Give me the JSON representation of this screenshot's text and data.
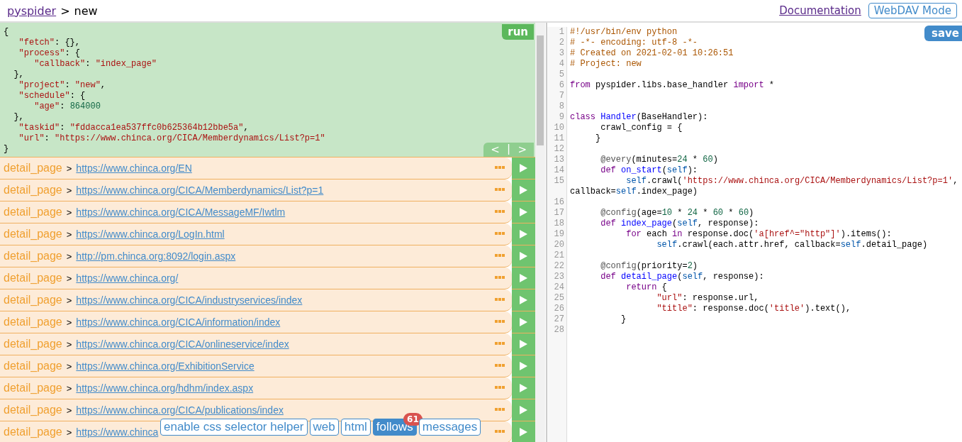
{
  "header": {
    "brand": "pyspider",
    "separator": ">",
    "project": "new",
    "links": [
      {
        "kind": "link",
        "label": "Documentation"
      },
      {
        "kind": "button",
        "label": "WebDAV Mode"
      }
    ]
  },
  "task": {
    "run_label": "run",
    "nav": {
      "prev": "<",
      "sep": "|",
      "next": ">"
    },
    "lines": [
      [
        {
          "kind": "plain",
          "t": "{"
        }
      ],
      [
        {
          "kind": "string",
          "t": "   \"fetch\""
        },
        {
          "kind": "plain",
          "t": ": {},"
        }
      ],
      [
        {
          "kind": "string",
          "t": "   \"process\""
        },
        {
          "kind": "plain",
          "t": ": {"
        }
      ],
      [
        {
          "kind": "string",
          "t": "      \"callback\""
        },
        {
          "kind": "plain",
          "t": ": "
        },
        {
          "kind": "string",
          "t": "\"index_page\""
        }
      ],
      [
        {
          "kind": "plain",
          "t": "  },"
        }
      ],
      [
        {
          "kind": "string",
          "t": "   \"project\""
        },
        {
          "kind": "plain",
          "t": ": "
        },
        {
          "kind": "string",
          "t": "\"new\""
        },
        {
          "kind": "plain",
          "t": ","
        }
      ],
      [
        {
          "kind": "string",
          "t": "   \"schedule\""
        },
        {
          "kind": "plain",
          "t": ": {"
        }
      ],
      [
        {
          "kind": "string",
          "t": "      \"age\""
        },
        {
          "kind": "plain",
          "t": ": "
        },
        {
          "kind": "number",
          "t": "864000"
        }
      ],
      [
        {
          "kind": "plain",
          "t": "  },"
        }
      ],
      [
        {
          "kind": "string",
          "t": "   \"taskid\""
        },
        {
          "kind": "plain",
          "t": ": "
        },
        {
          "kind": "string",
          "t": "\"fddacca1ea537ffc0b625364b12bbe5a\""
        },
        {
          "kind": "plain",
          "t": ","
        }
      ],
      [
        {
          "kind": "string",
          "t": "   \"url\""
        },
        {
          "kind": "plain",
          "t": ": "
        },
        {
          "kind": "string",
          "t": "\"https://www.chinca.org/CICA/Memberdynamics/List?p=1\""
        }
      ],
      [
        {
          "kind": "plain",
          "t": "}"
        }
      ]
    ]
  },
  "follows": [
    {
      "callback": "detail_page",
      "sep": ">",
      "url": "https://www.chinca.org/EN"
    },
    {
      "callback": "detail_page",
      "sep": ">",
      "url": "https://www.chinca.org/CICA/Memberdynamics/List?p=1"
    },
    {
      "callback": "detail_page",
      "sep": ">",
      "url": "https://www.chinca.org/CICA/MessageMF/Iwtlm"
    },
    {
      "callback": "detail_page",
      "sep": ">",
      "url": "https://www.chinca.org/LogIn.html"
    },
    {
      "callback": "detail_page",
      "sep": ">",
      "url": "http://pm.chinca.org:8092/login.aspx"
    },
    {
      "callback": "detail_page",
      "sep": ">",
      "url": "https://www.chinca.org/"
    },
    {
      "callback": "detail_page",
      "sep": ">",
      "url": "https://www.chinca.org/CICA/industryservices/index"
    },
    {
      "callback": "detail_page",
      "sep": ">",
      "url": "https://www.chinca.org/CICA/information/index"
    },
    {
      "callback": "detail_page",
      "sep": ">",
      "url": "https://www.chinca.org/CICA/onlineservice/index"
    },
    {
      "callback": "detail_page",
      "sep": ">",
      "url": "https://www.chinca.org/ExhibitionService"
    },
    {
      "callback": "detail_page",
      "sep": ">",
      "url": "https://www.chinca.org/hdhm/index.aspx"
    },
    {
      "callback": "detail_page",
      "sep": ">",
      "url": "https://www.chinca.org/CICA/publications/index"
    },
    {
      "callback": "detail_page",
      "sep": ">",
      "url": "https://www.chinca"
    }
  ],
  "toolbar": {
    "helper": "enable css selector helper",
    "tabs": [
      {
        "label": "web",
        "selected": false
      },
      {
        "label": "html",
        "selected": false
      },
      {
        "label": "follows",
        "selected": true,
        "badge": "61"
      },
      {
        "label": "messages",
        "selected": false
      }
    ]
  },
  "editor": {
    "save_label": "save",
    "lines": [
      {
        "n": "1",
        "segs": [
          {
            "kind": "comment",
            "t": "#!/usr/bin/env python"
          }
        ]
      },
      {
        "n": "2",
        "segs": [
          {
            "kind": "comment",
            "t": "# -*- encoding: utf-8 -*-"
          }
        ]
      },
      {
        "n": "3",
        "segs": [
          {
            "kind": "comment",
            "t": "# Created on 2021-02-01 10:26:51"
          }
        ]
      },
      {
        "n": "4",
        "segs": [
          {
            "kind": "comment",
            "t": "# Project: new"
          }
        ]
      },
      {
        "n": "5"
      },
      {
        "n": "6",
        "segs": [
          {
            "kind": "keyword",
            "t": "from"
          },
          {
            "kind": "plain",
            "t": " pyspider.libs.base_handler "
          },
          {
            "kind": "keyword",
            "t": "import"
          },
          {
            "kind": "plain",
            "t": " *"
          }
        ]
      },
      {
        "n": "7"
      },
      {
        "n": "8"
      },
      {
        "n": "9",
        "segs": [
          {
            "kind": "keyword",
            "t": "class"
          },
          {
            "kind": "def",
            "t": " Handler"
          },
          {
            "kind": "plain",
            "t": "(BaseHandler):"
          }
        ]
      },
      {
        "n": "10",
        "segs": [
          {
            "kind": "plain",
            "t": "      crawl_config = {"
          }
        ]
      },
      {
        "n": "11",
        "segs": [
          {
            "kind": "plain",
            "t": "     }"
          }
        ]
      },
      {
        "n": "12"
      },
      {
        "n": "13",
        "segs": [
          {
            "kind": "meta",
            "t": "      @every"
          },
          {
            "kind": "plain",
            "t": "(minutes="
          },
          {
            "kind": "number",
            "t": "24"
          },
          {
            "kind": "plain",
            "t": " * "
          },
          {
            "kind": "number",
            "t": "60"
          },
          {
            "kind": "plain",
            "t": ")"
          }
        ]
      },
      {
        "n": "14",
        "segs": [
          {
            "kind": "keyword",
            "t": "      def"
          },
          {
            "kind": "def",
            "t": " on_start"
          },
          {
            "kind": "plain",
            "t": "("
          },
          {
            "kind": "variable",
            "t": "self"
          },
          {
            "kind": "plain",
            "t": "):"
          }
        ]
      },
      {
        "n": "15",
        "segs": [
          {
            "kind": "variable",
            "t": "           self"
          },
          {
            "kind": "plain",
            "t": ".crawl("
          },
          {
            "kind": "string",
            "t": "'https://www.chinca.org/CICA/Memberdynamics/List?p=1'"
          },
          {
            "kind": "plain",
            "t": ","
          }
        ]
      },
      {
        "segs": [
          {
            "kind": "plain",
            "t": "callback="
          },
          {
            "kind": "variable",
            "t": "self"
          },
          {
            "kind": "plain",
            "t": ".index_page)"
          }
        ]
      },
      {
        "n": "16"
      },
      {
        "n": "17",
        "segs": [
          {
            "kind": "meta",
            "t": "      @config"
          },
          {
            "kind": "plain",
            "t": "(age="
          },
          {
            "kind": "number",
            "t": "10"
          },
          {
            "kind": "plain",
            "t": " * "
          },
          {
            "kind": "number",
            "t": "24"
          },
          {
            "kind": "plain",
            "t": " * "
          },
          {
            "kind": "number",
            "t": "60"
          },
          {
            "kind": "plain",
            "t": " * "
          },
          {
            "kind": "number",
            "t": "60"
          },
          {
            "kind": "plain",
            "t": ")"
          }
        ]
      },
      {
        "n": "18",
        "segs": [
          {
            "kind": "keyword",
            "t": "      def"
          },
          {
            "kind": "def",
            "t": " index_page"
          },
          {
            "kind": "plain",
            "t": "("
          },
          {
            "kind": "variable",
            "t": "self"
          },
          {
            "kind": "plain",
            "t": ", response):"
          }
        ]
      },
      {
        "n": "19",
        "segs": [
          {
            "kind": "keyword",
            "t": "           for"
          },
          {
            "kind": "plain",
            "t": " each "
          },
          {
            "kind": "keyword",
            "t": "in"
          },
          {
            "kind": "plain",
            "t": " response.doc("
          },
          {
            "kind": "string",
            "t": "'a[href^=\"http\"]'"
          },
          {
            "kind": "plain",
            "t": ").items():"
          }
        ]
      },
      {
        "n": "20",
        "segs": [
          {
            "kind": "variable",
            "t": "                 self"
          },
          {
            "kind": "plain",
            "t": ".crawl(each.attr.href, callback="
          },
          {
            "kind": "variable",
            "t": "self"
          },
          {
            "kind": "plain",
            "t": ".detail_page)"
          }
        ]
      },
      {
        "n": "21"
      },
      {
        "n": "22",
        "segs": [
          {
            "kind": "meta",
            "t": "      @config"
          },
          {
            "kind": "plain",
            "t": "(priority="
          },
          {
            "kind": "number",
            "t": "2"
          },
          {
            "kind": "plain",
            "t": ")"
          }
        ]
      },
      {
        "n": "23",
        "segs": [
          {
            "kind": "keyword",
            "t": "      def"
          },
          {
            "kind": "def",
            "t": " detail_page"
          },
          {
            "kind": "plain",
            "t": "("
          },
          {
            "kind": "variable",
            "t": "self"
          },
          {
            "kind": "plain",
            "t": ", response):"
          }
        ]
      },
      {
        "n": "24",
        "segs": [
          {
            "kind": "keyword",
            "t": "           return"
          },
          {
            "kind": "plain",
            "t": " {"
          }
        ]
      },
      {
        "n": "25",
        "segs": [
          {
            "kind": "string",
            "t": "                 \"url\""
          },
          {
            "kind": "plain",
            "t": ": response.url,"
          }
        ]
      },
      {
        "n": "26",
        "segs": [
          {
            "kind": "string",
            "t": "                 \"title\""
          },
          {
            "kind": "plain",
            "t": ": response.doc("
          },
          {
            "kind": "string",
            "t": "'title'"
          },
          {
            "kind": "plain",
            "t": ").text(),"
          }
        ]
      },
      {
        "n": "27",
        "segs": [
          {
            "kind": "plain",
            "t": "          }"
          }
        ]
      },
      {
        "n": "28"
      }
    ]
  }
}
